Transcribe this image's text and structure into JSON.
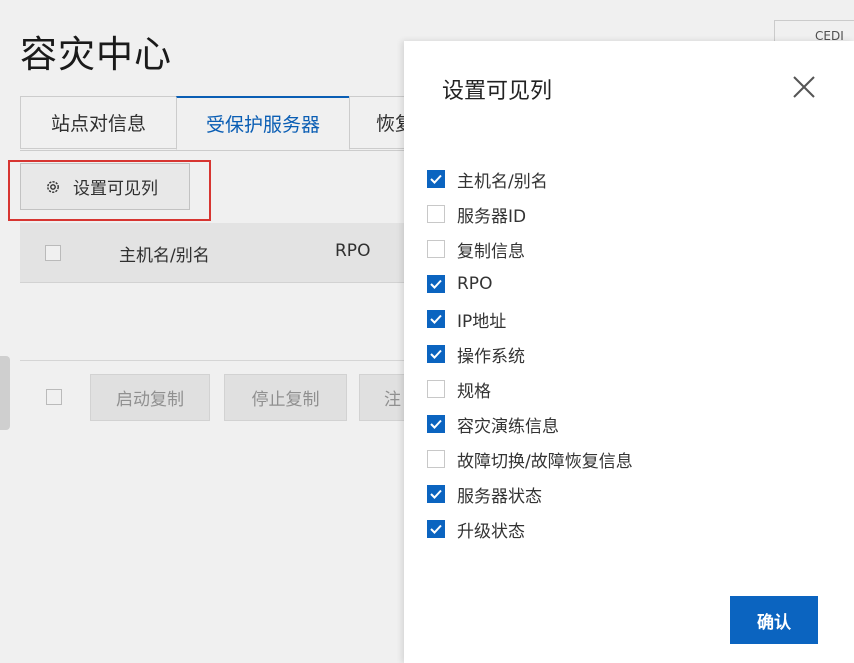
{
  "page": {
    "title": "容灾中心",
    "top_right_btn": "CEDI"
  },
  "tabs": [
    {
      "label": "站点对信息"
    },
    {
      "label": "受保护服务器",
      "active": true
    },
    {
      "label": "恢复"
    }
  ],
  "toolbar": {
    "column_settings_label": "设置可见列"
  },
  "table": {
    "columns": [
      "主机名/别名",
      "RPO"
    ]
  },
  "footer": {
    "buttons": [
      "启动复制",
      "停止复制",
      "注"
    ]
  },
  "modal": {
    "title": "设置可见列",
    "confirm_label": "确认",
    "options": [
      {
        "label": "主机名/别名",
        "checked": true
      },
      {
        "label": "服务器ID",
        "checked": false
      },
      {
        "label": "复制信息",
        "checked": false
      },
      {
        "label": "RPO",
        "checked": true
      },
      {
        "label": "IP地址",
        "checked": true
      },
      {
        "label": "操作系统",
        "checked": true
      },
      {
        "label": "规格",
        "checked": false
      },
      {
        "label": "容灾演练信息",
        "checked": true
      },
      {
        "label": "故障切换/故障恢复信息",
        "checked": false
      },
      {
        "label": "服务器状态",
        "checked": true
      },
      {
        "label": "升级状态",
        "checked": true
      }
    ]
  },
  "colors": {
    "accent": "#0b64c0",
    "highlight": "#e53935"
  }
}
